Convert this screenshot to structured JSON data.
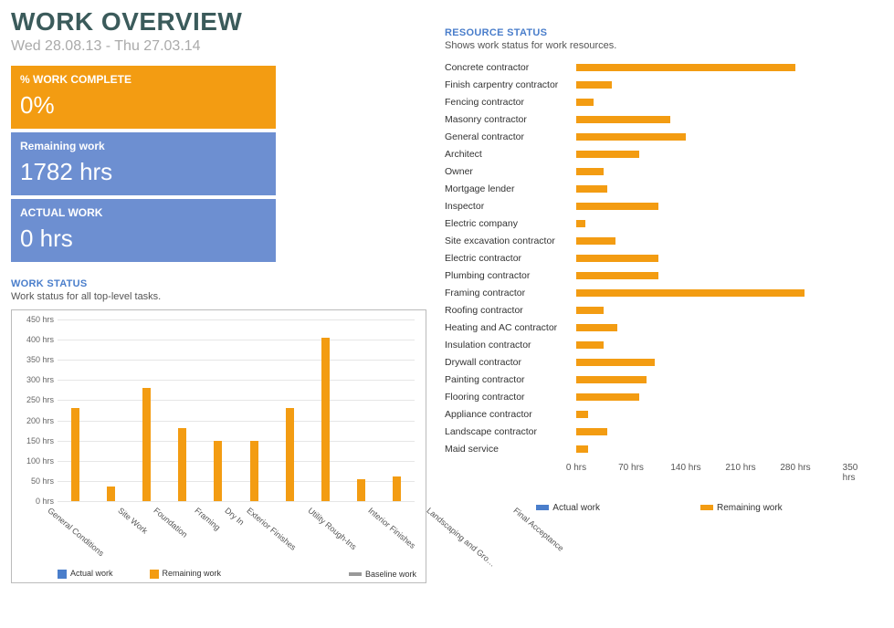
{
  "header": {
    "title": "WORK OVERVIEW",
    "date_range": "Wed 28.08.13 - Thu 27.03.14"
  },
  "cards": {
    "work_complete": {
      "label": "% WORK COMPLETE",
      "value": "0%"
    },
    "remaining": {
      "label": "Remaining work",
      "value": "1782 hrs"
    },
    "actual": {
      "label": "ACTUAL WORK",
      "value": "0 hrs"
    }
  },
  "work_status": {
    "title": "WORK STATUS",
    "subtitle": "Work status for all top-level tasks.",
    "legend": {
      "actual": "Actual work",
      "remaining": "Remaining work",
      "baseline": "Baseline work"
    }
  },
  "resource_status": {
    "title": "RESOURCE STATUS",
    "subtitle": "Shows work status for work resources.",
    "legend": {
      "actual": "Actual work",
      "remaining": "Remaining work"
    }
  },
  "chart_data": [
    {
      "type": "bar",
      "id": "work_status_chart",
      "ylabel": "hrs",
      "ylim": [
        0,
        450
      ],
      "yticks": [
        0,
        50,
        100,
        150,
        200,
        250,
        300,
        350,
        400,
        450
      ],
      "ytick_suffix": " hrs",
      "categories": [
        "General Conditions",
        "Site Work",
        "Foundation",
        "Framing",
        "Dry In",
        "Exterior Finishes",
        "Utility Rough-Ins",
        "Interior Finishes",
        "Landscaping and Gro…",
        "Final Acceptance"
      ],
      "series": [
        {
          "name": "Actual work",
          "color": "#4a7ecb",
          "values": [
            0,
            0,
            0,
            0,
            0,
            0,
            0,
            0,
            0,
            0
          ]
        },
        {
          "name": "Remaining work",
          "color": "#f39c12",
          "values": [
            230,
            36,
            280,
            180,
            150,
            150,
            230,
            405,
            54,
            62
          ]
        },
        {
          "name": "Baseline work",
          "color": "#999999",
          "values": [
            0,
            0,
            0,
            0,
            0,
            0,
            0,
            0,
            0,
            0
          ]
        }
      ]
    },
    {
      "type": "bar",
      "id": "resource_status_chart",
      "orientation": "horizontal",
      "xlim": [
        0,
        350
      ],
      "xticks": [
        0,
        70,
        140,
        210,
        280,
        350
      ],
      "xtick_suffix": " hrs",
      "categories": [
        "Concrete contractor",
        "Finish carpentry contractor",
        "Fencing contractor",
        "Masonry contractor",
        "General contractor",
        "Architect",
        "Owner",
        "Mortgage lender",
        "Inspector",
        "Electric company",
        "Site excavation contractor",
        "Electric contractor",
        "Plumbing contractor",
        "Framing contractor",
        "Roofing contractor",
        "Heating and AC contractor",
        "Insulation contractor",
        "Drywall contractor",
        "Painting contractor",
        "Flooring contractor",
        "Appliance contractor",
        "Landscape contractor",
        "Maid service"
      ],
      "series": [
        {
          "name": "Actual work",
          "color": "#4a7ecb",
          "values": [
            0,
            0,
            0,
            0,
            0,
            0,
            0,
            0,
            0,
            0,
            0,
            0,
            0,
            0,
            0,
            0,
            0,
            0,
            0,
            0,
            0,
            0,
            0
          ]
        },
        {
          "name": "Remaining work",
          "color": "#f39c12",
          "values": [
            280,
            45,
            22,
            120,
            140,
            80,
            35,
            40,
            105,
            12,
            50,
            105,
            105,
            292,
            35,
            52,
            35,
            100,
            90,
            80,
            15,
            40,
            15
          ]
        }
      ]
    }
  ]
}
